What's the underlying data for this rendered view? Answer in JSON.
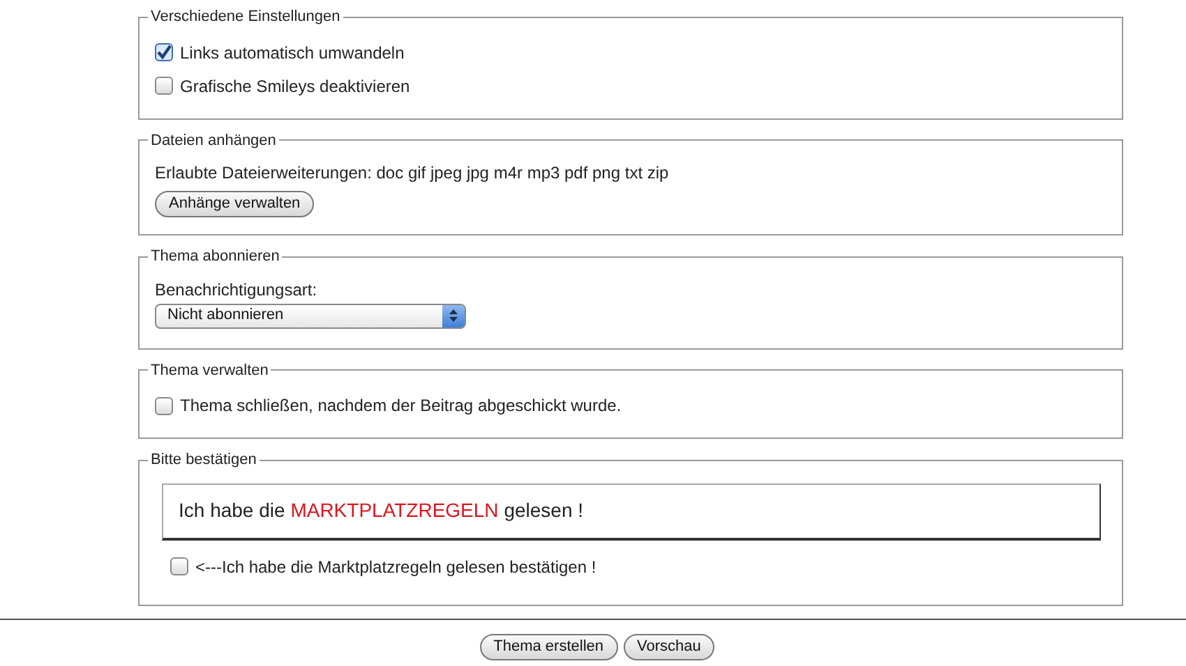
{
  "sections": [
    {
      "kind": "checkboxes",
      "legend": "Verschiedene Einstellungen",
      "items": [
        {
          "label": "Links automatisch umwandeln",
          "checked": true
        },
        {
          "label": "Grafische Smileys deaktivieren",
          "checked": false
        }
      ]
    },
    {
      "kind": "attachments",
      "legend": "Dateien anhängen",
      "text": "Erlaubte Dateierweiterungen: doc gif jpeg jpg m4r mp3 pdf png txt zip",
      "button": "Anhänge verwalten"
    },
    {
      "kind": "select",
      "legend": "Thema abonnieren",
      "label": "Benachrichtigungsart:",
      "value": "Nicht abonnieren"
    },
    {
      "kind": "checkboxes",
      "legend": "Thema verwalten",
      "items": [
        {
          "label": "Thema schließen, nachdem der Beitrag abgeschickt wurde.",
          "checked": false
        }
      ]
    },
    {
      "kind": "confirm",
      "legend": "Bitte bestätigen",
      "notice": {
        "before": "Ich habe die",
        "link": "MARKTPLATZREGELN",
        "after": "gelesen !"
      },
      "items": [
        {
          "label": "<---Ich habe die Marktplatzregeln gelesen bestätigen !",
          "checked": false
        }
      ]
    }
  ],
  "buttons": [
    "Thema erstellen",
    "Vorschau"
  ]
}
